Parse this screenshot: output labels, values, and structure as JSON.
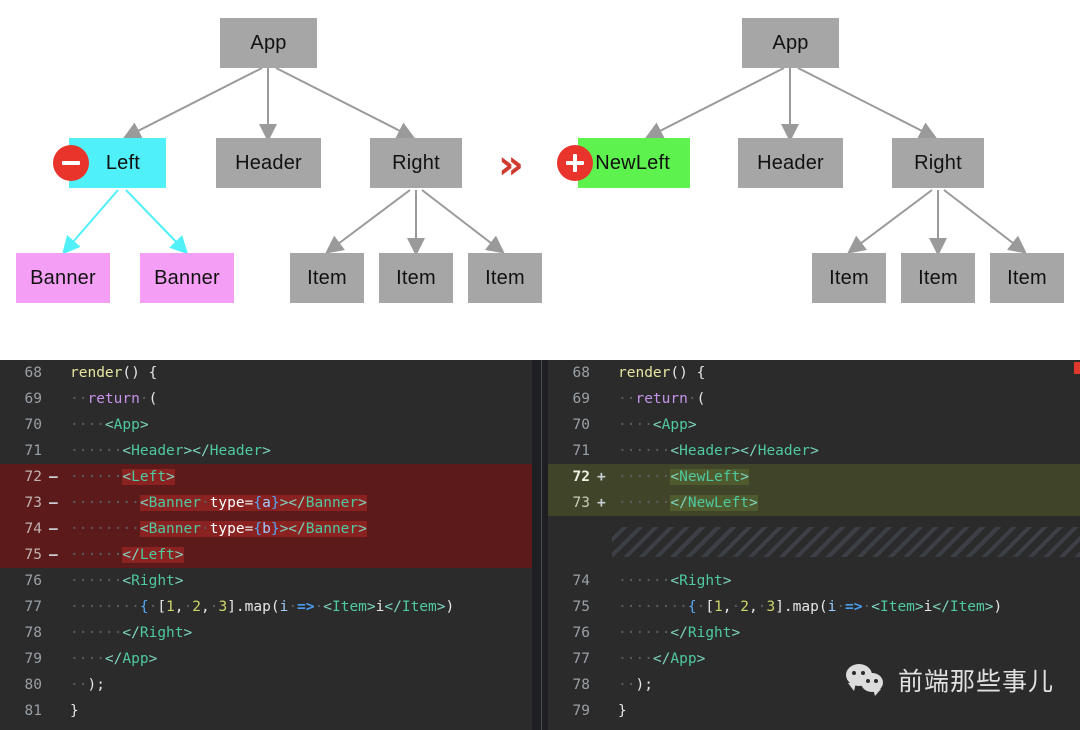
{
  "diagram": {
    "left_tree": {
      "title": "before",
      "nodes": {
        "app": "App",
        "left": "Left",
        "header": "Header",
        "right": "Right",
        "banner1": "Banner",
        "banner2": "Banner",
        "item1": "Item",
        "item2": "Item",
        "item3": "Item"
      },
      "badge": "minus",
      "highlight_color": "#4ff0f8",
      "leaf_color": "#f49ff5",
      "default_color": "#a6a6a6"
    },
    "transition_icon": "»",
    "transition_color": "#cf3b2e",
    "right_tree": {
      "title": "after",
      "nodes": {
        "app": "App",
        "newleft": "NewLeft",
        "header": "Header",
        "right": "Right",
        "item1": "Item",
        "item2": "Item",
        "item3": "Item"
      },
      "badge": "plus",
      "highlight_color": "#5ef24f",
      "default_color": "#a6a6a6"
    }
  },
  "code": {
    "theme": {
      "background": "#2b2b2b",
      "deletion_bg": "#5c1a1a",
      "addition_bg": "#40452a",
      "gutter_color": "#9aa0a6"
    },
    "left_pane": {
      "lines": [
        {
          "n": "68",
          "sign": "",
          "type": "ctx"
        },
        {
          "n": "69",
          "sign": "",
          "type": "ctx"
        },
        {
          "n": "70",
          "sign": "",
          "type": "ctx"
        },
        {
          "n": "71",
          "sign": "",
          "type": "ctx"
        },
        {
          "n": "72",
          "sign": "–",
          "type": "del"
        },
        {
          "n": "73",
          "sign": "–",
          "type": "del"
        },
        {
          "n": "74",
          "sign": "–",
          "type": "del"
        },
        {
          "n": "75",
          "sign": "–",
          "type": "del"
        },
        {
          "n": "76",
          "sign": "",
          "type": "ctx"
        },
        {
          "n": "77",
          "sign": "",
          "type": "ctx"
        },
        {
          "n": "78",
          "sign": "",
          "type": "ctx"
        },
        {
          "n": "79",
          "sign": "",
          "type": "ctx"
        },
        {
          "n": "80",
          "sign": "",
          "type": "ctx"
        },
        {
          "n": "81",
          "sign": "",
          "type": "ctx"
        }
      ],
      "text": [
        "render() {",
        "  return (",
        "    <App>",
        "      <Header></Header>",
        "      <Left>",
        "        <Banner type={a}></Banner>",
        "        <Banner type={b}></Banner>",
        "      </Left>",
        "      <Right>",
        "        { [1, 2, 3].map(i => <Item>i</Item>)",
        "      </Right>",
        "    </App>",
        "  );",
        "}"
      ]
    },
    "right_pane": {
      "lines": [
        {
          "n": "68",
          "sign": "",
          "type": "ctx"
        },
        {
          "n": "69",
          "sign": "",
          "type": "ctx"
        },
        {
          "n": "70",
          "sign": "",
          "type": "ctx"
        },
        {
          "n": "71",
          "sign": "",
          "type": "ctx"
        },
        {
          "n": "72",
          "sign": "+",
          "type": "add"
        },
        {
          "n": "73",
          "sign": "+",
          "type": "add"
        },
        {
          "n": "",
          "sign": "",
          "type": "hatch"
        },
        {
          "n": "74",
          "sign": "",
          "type": "ctx"
        },
        {
          "n": "75",
          "sign": "",
          "type": "ctx"
        },
        {
          "n": "76",
          "sign": "",
          "type": "ctx"
        },
        {
          "n": "77",
          "sign": "",
          "type": "ctx"
        },
        {
          "n": "78",
          "sign": "",
          "type": "ctx"
        },
        {
          "n": "79",
          "sign": "",
          "type": "ctx"
        }
      ],
      "text": [
        "render() {",
        "  return (",
        "    <App>",
        "      <Header></Header>",
        "      <NewLeft>",
        "      </NewLeft>",
        "",
        "      <Right>",
        "        { [1, 2, 3].map(i => <Item>i</Item>)",
        "      </Right>",
        "    </App>",
        "  );",
        "}"
      ]
    }
  },
  "watermark": {
    "text": "前端那些事儿",
    "logo": "wechat-logo"
  }
}
